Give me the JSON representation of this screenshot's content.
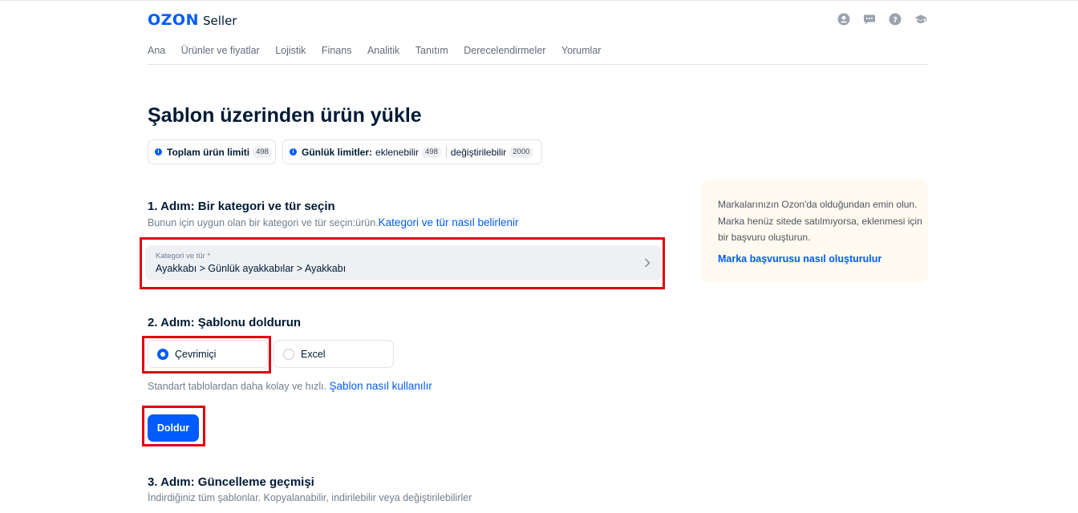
{
  "header": {
    "logo_brand": "OZON",
    "logo_product": "Seller",
    "icons": [
      "user-icon",
      "chat-icon",
      "help-icon",
      "education-icon"
    ]
  },
  "nav": {
    "items": [
      {
        "label": "Ana"
      },
      {
        "label": "Ürünler ve fiyatlar"
      },
      {
        "label": "Lojistik"
      },
      {
        "label": "Finans"
      },
      {
        "label": "Analitik"
      },
      {
        "label": "Tanıtım"
      },
      {
        "label": "Derecelendirmeler"
      },
      {
        "label": "Yorumlar"
      }
    ]
  },
  "page": {
    "title": "Şablon üzerinden ürün yükle"
  },
  "limits": {
    "total_label": "Toplam ürün limiti",
    "total_value": "498",
    "daily_label": "Günlük limitler:",
    "add_label": "eklenebilir",
    "add_value": "498",
    "edit_label": "değiştirilebilir",
    "edit_value": "2000"
  },
  "step1": {
    "title": "1. Adım: Bir kategori ve tür seçin",
    "desc": "Bunun için uygun olan bir kategori ve tür seçin:ürün.",
    "link": "Kategori ve tür nasıl belirlenir",
    "select_label": "Kategori ve tür *",
    "select_value": "Ayakkabı > Günlük ayakkabılar > Ayakkabı"
  },
  "step2": {
    "title": "2. Adım: Şablonu doldurun",
    "option_online": "Çevrimiçi",
    "option_excel": "Excel",
    "selected": "Çevrimiçi",
    "desc": "Standart tablolardan daha kolay ve hızlı.",
    "link": "Şablon nasıl kullanılır",
    "button": "Doldur"
  },
  "step3": {
    "title": "3. Adım: Güncelleme geçmişi",
    "desc": "İndirdiğiniz tüm şablonlar. Kopyalanabilir, indirilebilir veya değiştirilebilirler"
  },
  "aside": {
    "text": "Markalarınızın Ozon'da olduğundan emin olun. Marka henüz sitede satılmıyorsa, eklenmesi için bir başvuru oluşturun.",
    "link": "Marka başvurusu nasıl oluşturulur"
  },
  "colors": {
    "accent": "#005bff",
    "highlight": "#e0000f",
    "aside_bg": "#fffaf0"
  }
}
